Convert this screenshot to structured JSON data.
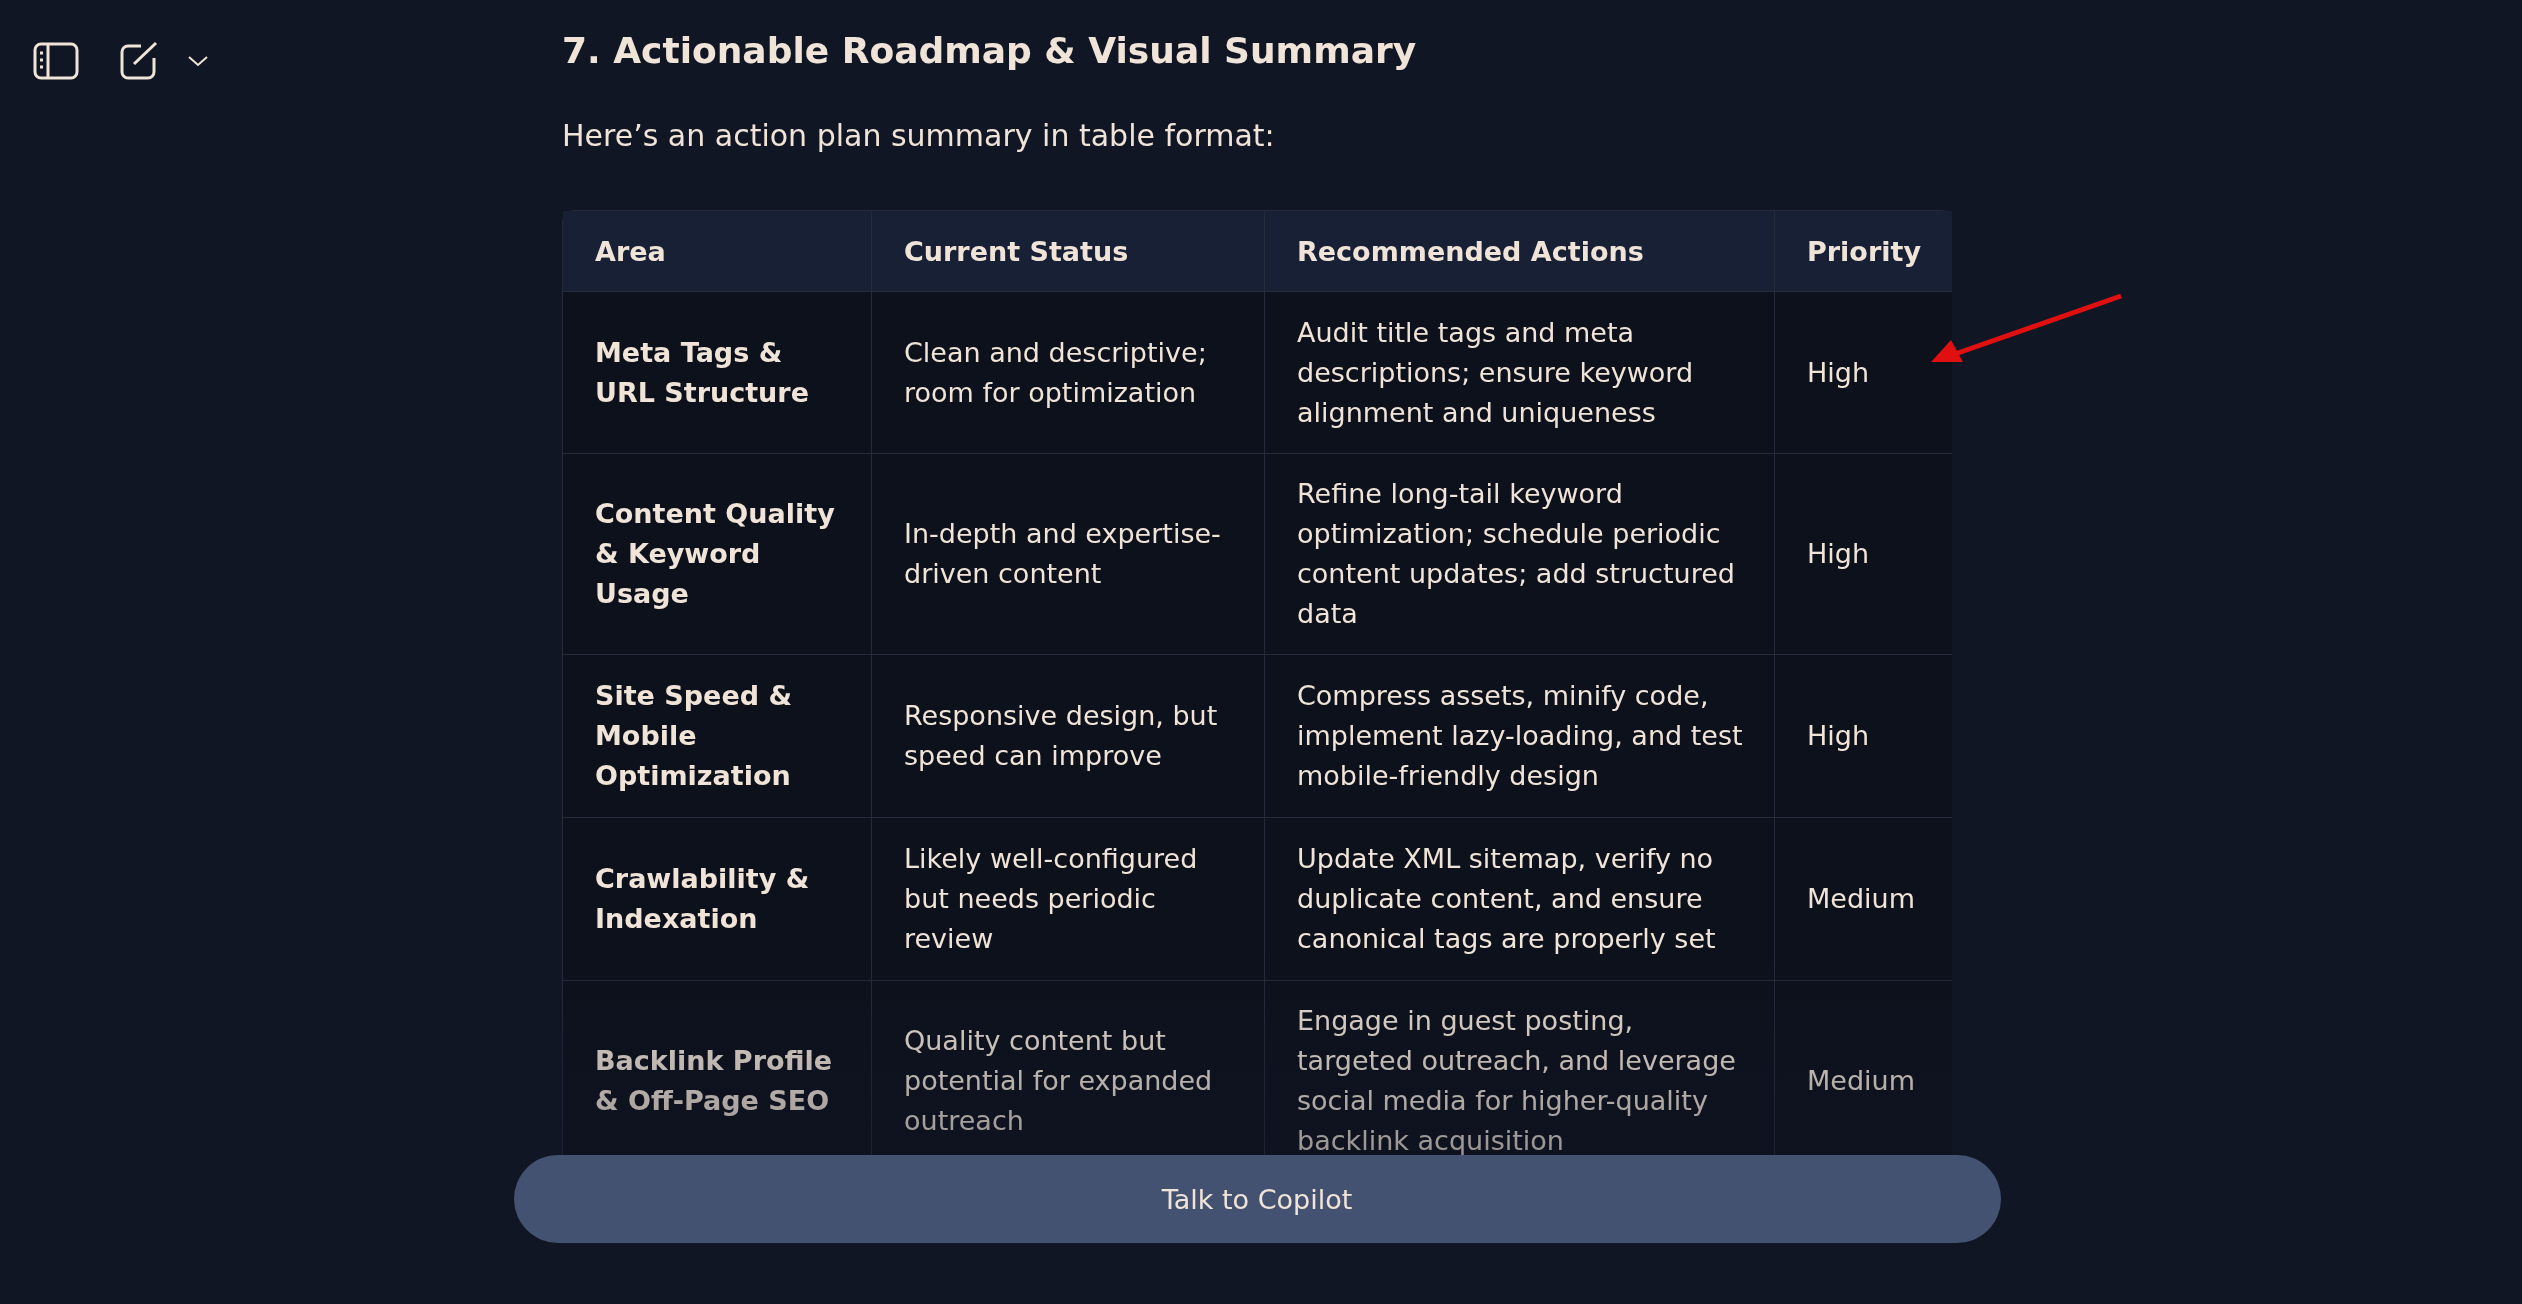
{
  "toolbar": {
    "buttons": [
      {
        "kind": "sidebar"
      },
      {
        "kind": "new-chat"
      },
      {
        "kind": "dropdown"
      }
    ]
  },
  "heading": "7. Actionable Roadmap & Visual Summary",
  "intro": "Here’s an action plan summary in table format:",
  "table": {
    "columns": [
      "Area",
      "Current Status",
      "Recommended Actions",
      "Priority"
    ],
    "rows": [
      [
        "Meta Tags & URL Structure",
        "Clean and descriptive; room for optimization",
        "Audit title tags and meta descriptions; ensure keyword alignment and uniqueness",
        "High"
      ],
      [
        "Content Quality & Keyword Usage",
        "In-depth and expertise-driven content",
        "Refine long-tail keyword optimization; schedule periodic content updates; add structured data",
        "High"
      ],
      [
        "Site Speed & Mobile Optimization",
        "Responsive design, but speed can improve",
        "Compress assets, minify code, implement lazy-loading, and test mobile-friendly design",
        "High"
      ],
      [
        "Crawlability & Indexation",
        "Likely well-configured but needs periodic review",
        "Update XML sitemap, verify no duplicate content, and ensure canonical tags are properly set",
        "Medium"
      ],
      [
        "Backlink Profile & Off-Page SEO",
        "Quality content but potential for expanded outreach",
        "Engage in guest posting, targeted outreach, and leverage social media for higher-quality backlink acquisition",
        "Medium"
      ]
    ]
  },
  "input_button": "Talk to Copilot"
}
